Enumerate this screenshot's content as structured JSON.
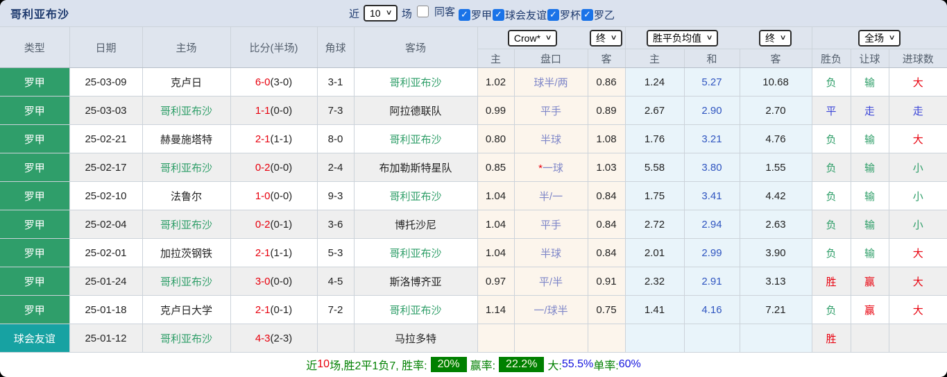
{
  "title": "哥利亚布沙",
  "topbar": {
    "near_label": "近",
    "near_value": "10",
    "games_label": "场",
    "filters": [
      {
        "label": "同客",
        "checked": false
      },
      {
        "label": "罗甲",
        "checked": true
      },
      {
        "label": "球会友谊",
        "checked": true
      },
      {
        "label": "罗杯",
        "checked": true
      },
      {
        "label": "罗乙",
        "checked": true
      }
    ]
  },
  "table": {
    "main_headers": [
      "类型",
      "日期",
      "主场",
      "比分(半场)",
      "角球",
      "客场"
    ],
    "selects": {
      "company": "Crow*",
      "company_final": "终",
      "avg": "胜平负均值",
      "avg_final": "终",
      "scope": "全场"
    },
    "sub_headers": [
      "主",
      "盘口",
      "客",
      "主",
      "和",
      "客",
      "胜负",
      "让球",
      "进球数"
    ],
    "rows": [
      {
        "league": "罗甲",
        "date": "25-03-09",
        "home": "克卢日",
        "score": "6-0",
        "half": "(3-0)",
        "corners": "3-1",
        "away": "哥利亚布沙",
        "odds_home": "1.02",
        "handicap": "球半/两",
        "odds_away": "0.86",
        "avg_home": "1.24",
        "avg_draw": "5.27",
        "avg_away": "10.68",
        "wdl": "负",
        "let_goal": "输",
        "goals": "大"
      },
      {
        "league": "罗甲",
        "date": "25-03-03",
        "home": "哥利亚布沙",
        "score": "1-1",
        "half": "(0-0)",
        "corners": "7-3",
        "away": "阿拉德联队",
        "odds_home": "0.99",
        "handicap": "平手",
        "odds_away": "0.89",
        "avg_home": "2.67",
        "avg_draw": "2.90",
        "avg_away": "2.70",
        "wdl": "平",
        "let_goal": "走",
        "goals": "走"
      },
      {
        "league": "罗甲",
        "date": "25-02-21",
        "home": "赫曼施塔特",
        "score": "2-1",
        "half": "(1-1)",
        "corners": "8-0",
        "away": "哥利亚布沙",
        "odds_home": "0.80",
        "handicap": "半球",
        "odds_away": "1.08",
        "avg_home": "1.76",
        "avg_draw": "3.21",
        "avg_away": "4.76",
        "wdl": "负",
        "let_goal": "输",
        "goals": "大"
      },
      {
        "league": "罗甲",
        "date": "25-02-17",
        "home": "哥利亚布沙",
        "score": "0-2",
        "half": "(0-0)",
        "corners": "2-4",
        "away": "布加勒斯特星队",
        "odds_home": "0.85",
        "handicap": "*一球",
        "odds_away": "1.03",
        "avg_home": "5.58",
        "avg_draw": "3.80",
        "avg_away": "1.55",
        "wdl": "负",
        "let_goal": "输",
        "goals": "小"
      },
      {
        "league": "罗甲",
        "date": "25-02-10",
        "home": "法鲁尔",
        "score": "1-0",
        "half": "(0-0)",
        "corners": "9-3",
        "away": "哥利亚布沙",
        "odds_home": "1.04",
        "handicap": "半/一",
        "odds_away": "0.84",
        "avg_home": "1.75",
        "avg_draw": "3.41",
        "avg_away": "4.42",
        "wdl": "负",
        "let_goal": "输",
        "goals": "小"
      },
      {
        "league": "罗甲",
        "date": "25-02-04",
        "home": "哥利亚布沙",
        "score": "0-2",
        "half": "(0-1)",
        "corners": "3-6",
        "away": "博托沙尼",
        "odds_home": "1.04",
        "handicap": "平手",
        "odds_away": "0.84",
        "avg_home": "2.72",
        "avg_draw": "2.94",
        "avg_away": "2.63",
        "wdl": "负",
        "let_goal": "输",
        "goals": "小"
      },
      {
        "league": "罗甲",
        "date": "25-02-01",
        "home": "加拉茨钢铁",
        "score": "2-1",
        "half": "(1-1)",
        "corners": "5-3",
        "away": "哥利亚布沙",
        "odds_home": "1.04",
        "handicap": "半球",
        "odds_away": "0.84",
        "avg_home": "2.01",
        "avg_draw": "2.99",
        "avg_away": "3.90",
        "wdl": "负",
        "let_goal": "输",
        "goals": "大"
      },
      {
        "league": "罗甲",
        "date": "25-01-24",
        "home": "哥利亚布沙",
        "score": "3-0",
        "half": "(0-0)",
        "corners": "4-5",
        "away": "斯洛博齐亚",
        "odds_home": "0.97",
        "handicap": "平/半",
        "odds_away": "0.91",
        "avg_home": "2.32",
        "avg_draw": "2.91",
        "avg_away": "3.13",
        "wdl": "胜",
        "let_goal": "赢",
        "goals": "大"
      },
      {
        "league": "罗甲",
        "date": "25-01-18",
        "home": "克卢日大学",
        "score": "2-1",
        "half": "(0-1)",
        "corners": "7-2",
        "away": "哥利亚布沙",
        "odds_home": "1.14",
        "handicap": "一/球半",
        "odds_away": "0.75",
        "avg_home": "1.41",
        "avg_draw": "4.16",
        "avg_away": "7.21",
        "wdl": "负",
        "let_goal": "赢",
        "goals": "大"
      },
      {
        "league": "球会友谊",
        "date": "25-01-12",
        "home": "哥利亚布沙",
        "score": "4-3",
        "half": "(2-3)",
        "corners": "",
        "away": "马拉多特",
        "odds_home": "",
        "handicap": "",
        "odds_away": "",
        "avg_home": "",
        "avg_draw": "",
        "avg_away": "",
        "wdl": "胜",
        "let_goal": "",
        "goals": ""
      }
    ]
  },
  "footer": {
    "parts": [
      {
        "text": "近",
        "style": "green"
      },
      {
        "text": "10",
        "style": "red"
      },
      {
        "text": "场,胜2平1负7, 胜率:",
        "style": "green"
      },
      {
        "text": "20%",
        "style": "badge"
      },
      {
        "text": "赢率:",
        "style": "green"
      },
      {
        "text": "22.2%",
        "style": "badge"
      },
      {
        "text": "大:",
        "style": "green"
      },
      {
        "text": "55.5%",
        "style": "blue"
      },
      {
        "text": " 单率:",
        "style": "green"
      },
      {
        "text": "60%",
        "style": "blue"
      }
    ]
  },
  "colors": {
    "league_bg": {
      "罗甲": "#2f9e6a",
      "球会友谊": "#17a2a2"
    },
    "team_highlight": "#2e9e68",
    "score_red": "#e8000d",
    "checkbox_blue": "#1a73e8",
    "badge_green": "#008000"
  },
  "result_color_map": {
    "胜": "red",
    "赢": "red",
    "大": "red",
    "平": "blue",
    "走": "blue",
    "负": "green",
    "输": "green",
    "小": "green"
  }
}
